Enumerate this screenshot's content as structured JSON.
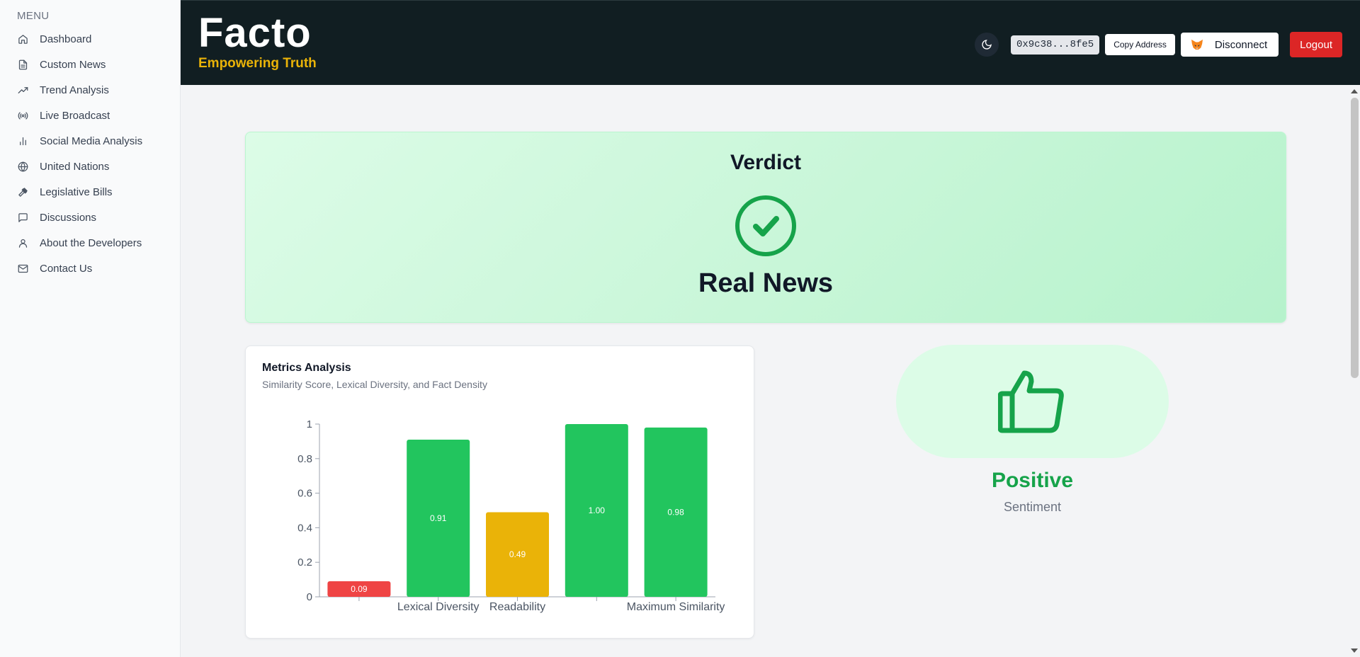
{
  "sidebar": {
    "menu_title": "MENU",
    "items": [
      {
        "label": "Dashboard",
        "icon": "home-icon"
      },
      {
        "label": "Custom News",
        "icon": "document-icon"
      },
      {
        "label": "Trend Analysis",
        "icon": "trending-up-icon"
      },
      {
        "label": "Live Broadcast",
        "icon": "broadcast-icon"
      },
      {
        "label": "Social Media Analysis",
        "icon": "bar-chart-icon"
      },
      {
        "label": "United Nations",
        "icon": "globe-icon"
      },
      {
        "label": "Legislative Bills",
        "icon": "gavel-icon"
      },
      {
        "label": "Discussions",
        "icon": "message-icon"
      },
      {
        "label": "About the Developers",
        "icon": "user-icon"
      },
      {
        "label": "Contact Us",
        "icon": "mail-icon"
      }
    ]
  },
  "header": {
    "brand_name": "Facto",
    "tagline": "Empowering Truth",
    "wallet_address": "0x9c38...8fe5",
    "copy_label": "Copy Address",
    "disconnect_label": "Disconnect",
    "logout_label": "Logout",
    "theme_icon": "moon-icon",
    "wallet_icon": "metamask-fox-icon"
  },
  "verdict": {
    "title": "Verdict",
    "result": "Real News",
    "icon": "check-circle-icon",
    "color": "#16a34a"
  },
  "metrics": {
    "title": "Metrics Analysis",
    "subtitle": "Similarity Score, Lexical Diversity, and Fact Density"
  },
  "sentiment": {
    "label": "Positive",
    "sublabel": "Sentiment",
    "icon": "thumbs-up-icon",
    "color": "#16a34a"
  },
  "chart_data": {
    "type": "bar",
    "categories": [
      "",
      "Lexical Diversity",
      "Readability",
      "",
      "Maximum Similarity"
    ],
    "values": [
      0.09,
      0.91,
      0.49,
      1.0,
      0.98
    ],
    "value_labels": [
      "0.09",
      "0.91",
      "0.49",
      "1.00",
      "0.98"
    ],
    "colors": [
      "#ef4444",
      "#22c55e",
      "#eab308",
      "#22c55e",
      "#22c55e"
    ],
    "yticks": [
      "0",
      "0.2",
      "0.4",
      "0.6",
      "0.8",
      "1"
    ],
    "ylim": [
      0,
      1
    ],
    "grid": false
  }
}
